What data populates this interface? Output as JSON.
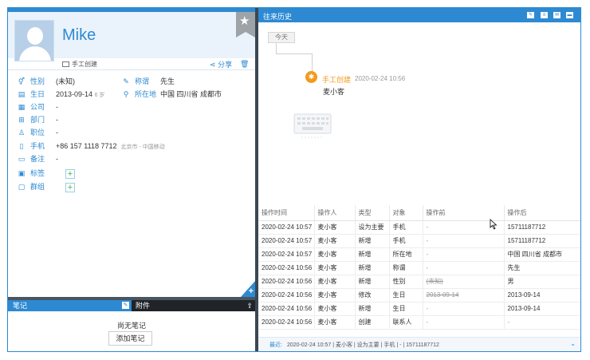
{
  "contact": {
    "name": "Mike",
    "source": "手工创建",
    "share_label": "分享"
  },
  "fields": [
    {
      "id": "gender",
      "label": "性别",
      "value": "(未知)"
    },
    {
      "id": "birthday",
      "label": "生日",
      "value": "2013-09-14",
      "extra": "6 岁"
    },
    {
      "id": "company",
      "label": "公司",
      "value": "-"
    },
    {
      "id": "department",
      "label": "部门",
      "value": "-"
    },
    {
      "id": "position",
      "label": "职位",
      "value": "-"
    },
    {
      "id": "mobile",
      "label": "手机",
      "value": "+86 157 1118 7712",
      "extra": "北京市 - 中国移动"
    },
    {
      "id": "remark",
      "label": "备注",
      "value": "-"
    },
    {
      "id": "tags",
      "label": "标签",
      "value": ""
    },
    {
      "id": "groups",
      "label": "群组",
      "value": ""
    }
  ],
  "side_fields": [
    {
      "id": "title",
      "label": "称谓",
      "value": "先生"
    },
    {
      "id": "location",
      "label": "所在地",
      "value": "中国 四川省 成都市"
    }
  ],
  "bottom_tabs": {
    "notes": "笔记",
    "files": "附件",
    "empty_notes": "尚无笔记",
    "add_note": "添加笔记"
  },
  "history": {
    "title": "往来历史",
    "today": "今天",
    "event_type": "手工创建",
    "event_time": "2020-02-24 10:56",
    "event_user": "麦小客"
  },
  "log_table": {
    "columns": [
      "操作时间",
      "操作人",
      "类型",
      "对象",
      "操作前",
      "操作后"
    ],
    "rows": [
      [
        "2020-02-24 10:57",
        "麦小客",
        "设为主要",
        "手机",
        "-",
        "15711187712"
      ],
      [
        "2020-02-24 10:57",
        "麦小客",
        "新增",
        "手机",
        "-",
        "15711187712"
      ],
      [
        "2020-02-24 10:57",
        "麦小客",
        "新增",
        "所在地",
        "-",
        "中国 四川省 成都市"
      ],
      [
        "2020-02-24 10:56",
        "麦小客",
        "新增",
        "称谓",
        "-",
        "先生"
      ],
      [
        "2020-02-24 10:56",
        "麦小客",
        "新增",
        "性别",
        "(未知)",
        "男"
      ],
      [
        "2020-02-24 10:56",
        "麦小客",
        "修改",
        "生日",
        "2013-09-14",
        "2013-09-14"
      ],
      [
        "2020-02-24 10:56",
        "麦小客",
        "新增",
        "生日",
        "-",
        "2013-09-14"
      ],
      [
        "2020-02-24 10:56",
        "麦小客",
        "创建",
        "联系人",
        "-",
        "-"
      ]
    ],
    "struck_rows": [
      4,
      5
    ]
  },
  "latest": {
    "label": "最近:",
    "text": "2020-02-24 10:57 | 麦小客 | 设为主要 | 手机 | - | 15711187712"
  },
  "colors": {
    "accent": "#2d8ad2",
    "timeline_dot": "#f39a1e",
    "add_plus": "#3bb34a"
  },
  "icons": [
    "star-icon",
    "monitor-icon",
    "share-icon",
    "trash-icon",
    "gender-icon",
    "cake-icon",
    "building-icon",
    "org-icon",
    "person-icon",
    "phone-icon",
    "note-icon",
    "tag-icon",
    "folder-icon",
    "pen-icon",
    "pin-icon",
    "plus-icon",
    "edit-icon",
    "upload-icon",
    "keyboard-icon",
    "chevron-down-icon",
    "mail-icon",
    "chat-icon"
  ]
}
